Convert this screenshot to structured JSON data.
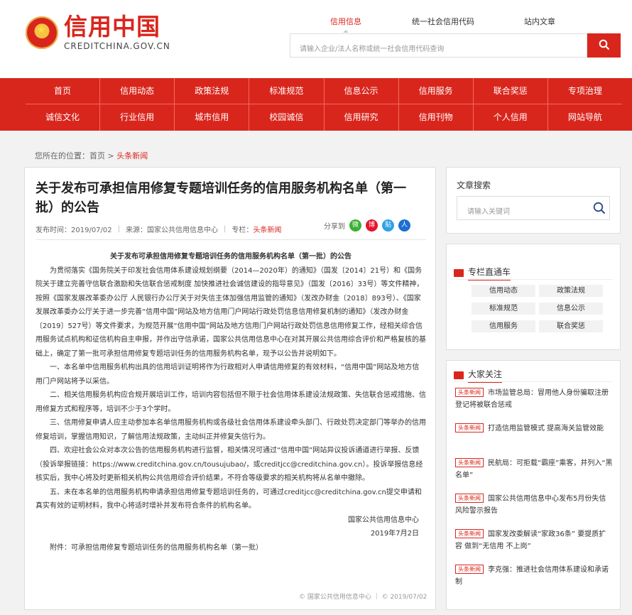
{
  "header": {
    "logo_cn": "信用中国",
    "logo_en": "CREDITCHINA.GOV.CN",
    "tabs": [
      "信用信息",
      "统一社会信用代码",
      "站内文章"
    ],
    "search_placeholder": "请输入企业/法人名称或统一社会信用代码查询"
  },
  "nav": {
    "row1": [
      "首页",
      "信用动态",
      "政策法规",
      "标准规范",
      "信息公示",
      "信用服务",
      "联合奖惩",
      "专项治理"
    ],
    "row2": [
      "诚信文化",
      "行业信用",
      "城市信用",
      "校园诚信",
      "信用研究",
      "信用刊物",
      "个人信用",
      "网站导航"
    ]
  },
  "breadcrumb": {
    "prefix": "您所在的位置：",
    "home": "首页",
    "arrow": ">",
    "current": "头条新闻"
  },
  "article": {
    "title": "关于发布可承担信用修复专题培训任务的信用服务机构名单（第一批）的公告",
    "date": "发布时间：2019/07/02",
    "source": "来源：国家公共信用信息中心",
    "column_label": "专栏：",
    "column": "头条新闻",
    "share_label": "分享到",
    "share": [
      {
        "name": "wechat",
        "glyph": "微",
        "color": "#3cb034"
      },
      {
        "name": "weibo",
        "glyph": "博",
        "color": "#e6162d"
      },
      {
        "name": "tieba",
        "glyph": "贴",
        "color": "#2fa1e8"
      },
      {
        "name": "renren",
        "glyph": "人",
        "color": "#1d6fce"
      }
    ],
    "subtitle": "关于发布可承担信用修复专题培训任务的信用服务机构名单（第一批）的公告",
    "paragraphs": [
      "为贯彻落实《国务院关于印发社会信用体系建设规划纲要（2014—2020年）的通知》（国发〔2014〕21号）和《国务院关于建立完善守信联合激励和失信联合惩戒制度 加快推进社会诚信建设的指导意见》（国发〔2016〕33号）等文件精神，按照《国家发展改革委办公厅 人民银行办公厅关于对失信主体加强信用监管的通知》（发改办财金〔2018〕893号）、《国家发展改革委办公厅关于进一步完善“信用中国”网站及地方信用门户网站行政处罚信息信用修复机制的通知》（发改办财金〔2019〕527号）等文件要求，为规范开展“信用中国”网站及地方信用门户网站行政处罚信息信用修复工作，经相关综合信用服务试点机构和征信机构自主申报，并作出守信承诺，国家公共信用信息中心在对其开展公共信用综合评价和严格复核的基础上，确定了第一批可承担信用修复专题培训任务的信用服务机构名单，现予以公告并说明如下。",
      "一、本名单中信用服务机构出具的信用培训证明将作为行政相对人申请信用修复的有效材料，“信用中国”网站及地方信用门户网站将予以采信。",
      "二、相关信用服务机构应合规开展培训工作，培训内容包括但不限于社会信用体系建设法规政策、失信联合惩戒措施、信用修复方式和程序等，培训不少于3个学时。",
      "三、信用修复申请人应主动参加本名单信用服务机构或各级社会信用体系建设牵头部门、行政处罚决定部门等举办的信用修复培训，掌握信用知识，了解信用法规政策，主动纠正并修复失信行为。",
      "四、欢迎社会公众对本次公告的信用服务机构进行监督，相关情况可通过“信用中国”网站异议投诉通道进行举报、反馈（投诉举报链接：https://www.creditchina.gov.cn/tousujubao/，或creditjcc@creditchina.gov.cn）。投诉举报信息经核实后，我中心将及时更新相关机构公共信用综合评价结果，不符合等级要求的相关机构将从名单中撤除。",
      "五、未在本名单的信用服务机构申请承担信用修复专题培训任务的，可通过creditjcc@creditchina.gov.cn提交申请和真实有效的证明材料，我中心将适时增补并发布符合条件的机构名单。"
    ],
    "signature_org": "国家公共信用信息中心",
    "signature_date": "2019年7月2日",
    "attachment": "附件：可承担信用修复专题培训任务的信用服务机构名单（第一批）",
    "footer_source": "© 国家公共信用信息中心 ｜ © 2019/07/02"
  },
  "sidebar": {
    "search_title": "文章搜索",
    "search_placeholder": "请输入关键词",
    "column_title": "专栏直通车",
    "columns": [
      "信用动态",
      "政策法规",
      "标准规范",
      "信息公示",
      "信用服务",
      "联合奖惩"
    ],
    "hot_title": "大家关注",
    "hot_tag": "头条新闻",
    "hot": [
      "市场监管总局：冒用他人身份骗取注册登记将被联合惩戒",
      "打造信用监管模式 提高海关监管效能",
      "民航局：可拒载“霸座”乘客，并列入“黑名单”",
      "国家公共信用信息中心发布5月份失信风险警示报告",
      "国家发改委解读“家政36条” 要提质扩容 做到“无信用 不上岗”",
      "李克强：推进社会信用体系建设和承诺制"
    ]
  },
  "colors": {
    "brand_red": "#d9261c"
  }
}
